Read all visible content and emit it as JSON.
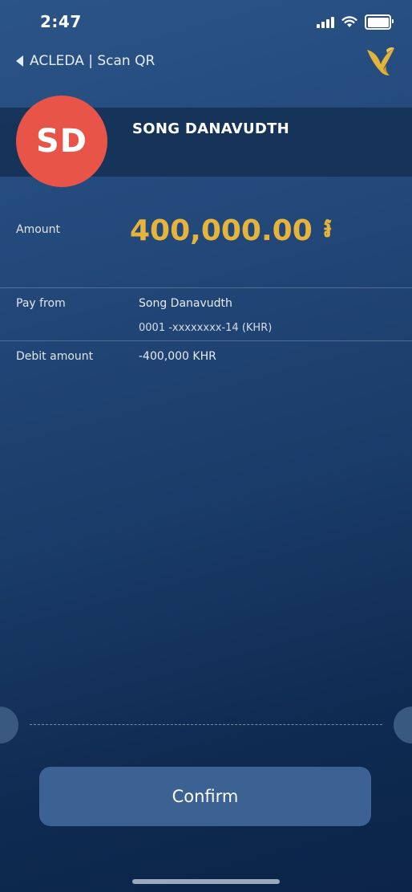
{
  "status_bar": {
    "time": "2:47"
  },
  "nav": {
    "back_label": "ACLEDA | Scan QR"
  },
  "payee": {
    "initials": "SD",
    "name": "SONG DANAVUDTH"
  },
  "amount": {
    "label": "Amount",
    "value": "400,000.00",
    "currency_symbol": "៛"
  },
  "pay_from": {
    "label": "Pay from",
    "account_name": "Song Danavudth",
    "account_number": "0001 -xxxxxxxx-14 (KHR)"
  },
  "debit": {
    "label": "Debit amount",
    "value": "-400,000 KHR"
  },
  "actions": {
    "confirm_label": "Confirm"
  },
  "colors": {
    "accent_gold": "#e6b43c",
    "avatar_red": "#e85447",
    "button_blue": "#3b6293"
  }
}
